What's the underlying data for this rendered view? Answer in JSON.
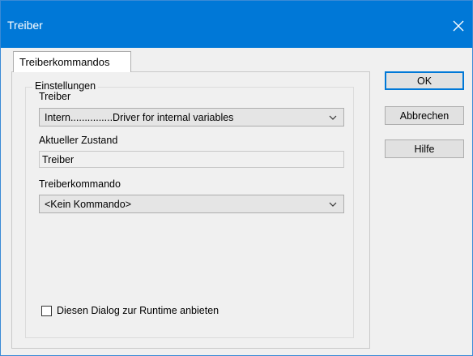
{
  "window": {
    "title": "Treiber"
  },
  "tabs": [
    {
      "label": "Treiberkommandos"
    }
  ],
  "settings": {
    "group_label": "Einstellungen",
    "driver_label": "Treiber",
    "driver_value": "Intern...............Driver for internal variables",
    "state_label": "Aktueller Zustand",
    "state_value": "Treiber",
    "command_label": "Treiberkommando",
    "command_value": "<Kein Kommando>",
    "runtime_checkbox_label": "Diesen Dialog zur Runtime anbieten",
    "runtime_checkbox_checked": false
  },
  "buttons": {
    "ok": "OK",
    "cancel": "Abbrechen",
    "help": "Hilfe"
  },
  "colors": {
    "titlebar": "#0078d7",
    "accent": "#0078d7"
  },
  "icons": {
    "close": "close-icon",
    "dropdown": "chevron-down-icon"
  }
}
